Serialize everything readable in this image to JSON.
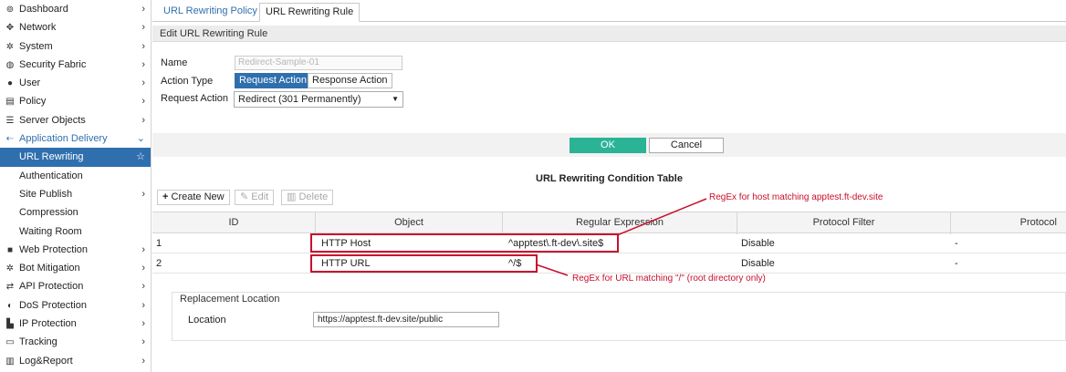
{
  "sidebar": {
    "items": [
      {
        "label": "Dashboard",
        "icon": "⊚",
        "icon_name": "dashboard-icon",
        "chevron": "›",
        "state": ""
      },
      {
        "label": "Network",
        "icon": "✥",
        "icon_name": "network-icon",
        "chevron": "›",
        "state": ""
      },
      {
        "label": "System",
        "icon": "✲",
        "icon_name": "system-gear-icon",
        "chevron": "›",
        "state": ""
      },
      {
        "label": "Security Fabric",
        "icon": "◍",
        "icon_name": "security-fabric-icon",
        "chevron": "›",
        "state": ""
      },
      {
        "label": "User",
        "icon": "●",
        "icon_name": "user-icon",
        "chevron": "›",
        "state": ""
      },
      {
        "label": "Policy",
        "icon": "▤",
        "icon_name": "policy-icon",
        "chevron": "›",
        "state": ""
      },
      {
        "label": "Server Objects",
        "icon": "☰",
        "icon_name": "server-objects-icon",
        "chevron": "›",
        "state": ""
      },
      {
        "label": "Application Delivery",
        "icon": "⇠",
        "icon_name": "application-delivery-icon",
        "chevron": "⌄",
        "state": "parent-active"
      },
      {
        "label": "URL Rewriting",
        "icon": "",
        "icon_name": "",
        "chevron": "☆",
        "state": "selected sub"
      },
      {
        "label": "Authentication",
        "icon": "",
        "icon_name": "",
        "chevron": "",
        "state": "sub"
      },
      {
        "label": "Site Publish",
        "icon": "",
        "icon_name": "",
        "chevron": "›",
        "state": "sub"
      },
      {
        "label": "Compression",
        "icon": "",
        "icon_name": "",
        "chevron": "",
        "state": "sub"
      },
      {
        "label": "Waiting Room",
        "icon": "",
        "icon_name": "",
        "chevron": "",
        "state": "sub"
      },
      {
        "label": "Web Protection",
        "icon": "■",
        "icon_name": "web-protection-lock-icon",
        "chevron": "›",
        "state": ""
      },
      {
        "label": "Bot Mitigation",
        "icon": "✲",
        "icon_name": "bot-mitigation-icon",
        "chevron": "›",
        "state": ""
      },
      {
        "label": "API Protection",
        "icon": "⇄",
        "icon_name": "api-protection-icon",
        "chevron": "›",
        "state": ""
      },
      {
        "label": "DoS Protection",
        "icon": "◐",
        "icon_name": "dos-protection-icon",
        "chevron": "›",
        "state": ""
      },
      {
        "label": "IP Protection",
        "icon": "▙",
        "icon_name": "ip-protection-icon",
        "chevron": "›",
        "state": ""
      },
      {
        "label": "Tracking",
        "icon": "▭",
        "icon_name": "tracking-icon",
        "chevron": "›",
        "state": ""
      },
      {
        "label": "Log&Report",
        "icon": "▥",
        "icon_name": "log-report-icon",
        "chevron": "›",
        "state": ""
      }
    ]
  },
  "tabs": [
    {
      "label": "URL Rewriting Policy",
      "active": false
    },
    {
      "label": "URL Rewriting Rule",
      "active": true
    }
  ],
  "form": {
    "section_title": "Edit URL Rewriting Rule",
    "name_label": "Name",
    "name_value": "Redirect-Sample-01",
    "action_type_label": "Action Type",
    "action_type_options": [
      "Request Action",
      "Response Action"
    ],
    "request_action_label": "Request Action",
    "request_action_value": "Redirect (301 Permanently)",
    "ok_label": "OK",
    "cancel_label": "Cancel"
  },
  "condition_table": {
    "title": "URL Rewriting Condition Table",
    "toolbar": {
      "create_new": "Create New",
      "edit": "Edit",
      "delete": "Delete"
    },
    "columns": [
      "ID",
      "Object",
      "Regular Expression",
      "Protocol Filter",
      "Protocol"
    ],
    "rows": [
      {
        "id": "1",
        "object": "HTTP Host",
        "regex": "^apptest\\.ft-dev\\.site$",
        "protocol_filter": "Disable",
        "protocol": "-"
      },
      {
        "id": "2",
        "object": "HTTP URL",
        "regex": "^/$",
        "protocol_filter": "Disable",
        "protocol": "-"
      }
    ]
  },
  "annotations": {
    "host_note": "RegEx for host matching apptest.ft-dev.site",
    "url_note": "RegEx for URL matching \"/\" (root directory only)"
  },
  "replacement": {
    "group_label": "Replacement Location",
    "location_label": "Location",
    "location_value": "https://apptest.ft-dev.site/public"
  },
  "colors": {
    "accent": "#2f6fae",
    "ok_button": "#2bb395",
    "annotation_red": "#c8102e"
  }
}
